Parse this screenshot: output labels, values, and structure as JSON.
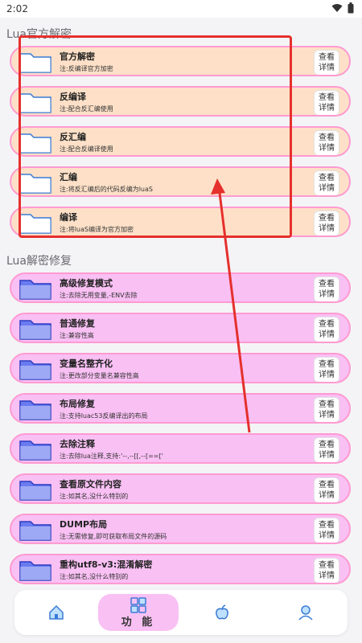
{
  "status": {
    "time": "2:02"
  },
  "sections": [
    {
      "title": "Lua官方解密",
      "style": "orange",
      "items": [
        {
          "title": "官方解密",
          "sub": "注:反编译官方加密",
          "btn_top": "查看",
          "btn_bottom": "详情"
        },
        {
          "title": "反编译",
          "sub": "注:配合反汇编使用",
          "btn_top": "查看",
          "btn_bottom": "详情"
        },
        {
          "title": "反汇编",
          "sub": "注:配合反编译使用",
          "btn_top": "查看",
          "btn_bottom": "详情"
        },
        {
          "title": "汇编",
          "sub": "注:将反汇编后的代码反编为luaS",
          "btn_top": "查看",
          "btn_bottom": "详情"
        },
        {
          "title": "编译",
          "sub": "注:将luaS编译为官方加密",
          "btn_top": "查看",
          "btn_bottom": "详情"
        }
      ]
    },
    {
      "title": "Lua解密修复",
      "style": "pink",
      "items": [
        {
          "title": "高级修复模式",
          "sub": "注:去除无用变量,-ENV去除",
          "btn_top": "查看",
          "btn_bottom": "详情"
        },
        {
          "title": "普通修复",
          "sub": "注:兼容性高",
          "btn_top": "查看",
          "btn_bottom": "详情"
        },
        {
          "title": "变量名整齐化",
          "sub": "注:更改部分变量名兼容性高",
          "btn_top": "查看",
          "btn_bottom": "详情"
        },
        {
          "title": "布局修复",
          "sub": "注:支持luac53反编译出的布局",
          "btn_top": "查看",
          "btn_bottom": "详情"
        },
        {
          "title": "去除注释",
          "sub": "注:去除lua注释,支持:'--,--[[,--[==['",
          "btn_top": "查看",
          "btn_bottom": "详情"
        },
        {
          "title": "查看原文件内容",
          "sub": "注:如其名,没什么特别的",
          "btn_top": "查看",
          "btn_bottom": "详情"
        },
        {
          "title": "DUMP布局",
          "sub": "注:无需修复,即可获取布局文件的源码",
          "btn_top": "查看",
          "btn_bottom": "详情"
        },
        {
          "title": "重构utf8-v3:混淆解密",
          "sub": "注:如其名,没什么特别的",
          "btn_top": "查看",
          "btn_bottom": "详情"
        }
      ]
    }
  ],
  "nav": {
    "active_label": "功 能",
    "items": [
      "home-icon",
      "function-icon",
      "apple-icon",
      "user-icon"
    ]
  },
  "colors": {
    "orange_row": "#fde0c7",
    "pink_row": "#f9c0f4",
    "row_border": "#ff9ad1",
    "annotation_red": "#e5302d"
  }
}
